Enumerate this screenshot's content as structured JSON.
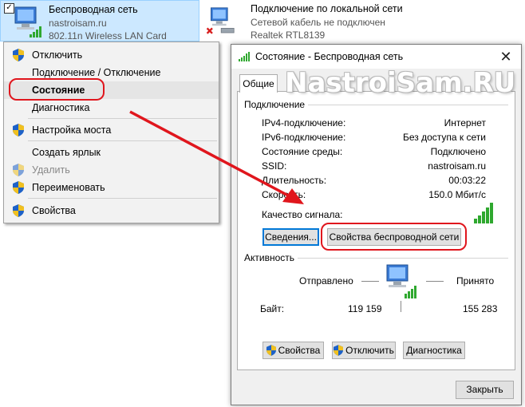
{
  "adapters": [
    {
      "name": "Беспроводная сеть",
      "line2": "nastroisam.ru",
      "line3": "802.11n Wireless LAN Card"
    },
    {
      "name": "Подключение по локальной сети",
      "line2": "Сетевой кабель не подключен",
      "line3": "Realtek RTL8139"
    }
  ],
  "context_menu": {
    "items": [
      {
        "label": "Отключить",
        "icon": "shield-icon",
        "enabled": true
      },
      {
        "label": "Подключение / Отключение",
        "enabled": true
      },
      {
        "label": "Состояние",
        "enabled": true,
        "highlighted": true
      },
      {
        "label": "Диагностика",
        "enabled": true
      },
      {
        "label": "Настройка моста",
        "icon": "shield-icon",
        "enabled": true
      },
      {
        "label": "Создать ярлык",
        "enabled": true
      },
      {
        "label": "Удалить",
        "icon": "shield-icon",
        "enabled": false
      },
      {
        "label": "Переименовать",
        "icon": "shield-icon",
        "enabled": true
      },
      {
        "label": "Свойства",
        "icon": "shield-icon",
        "enabled": true
      }
    ]
  },
  "dialog": {
    "title": "Состояние - Беспроводная сеть",
    "close_symbol": "✕",
    "tab": "Общие",
    "connection": {
      "group_label": "Подключение",
      "rows": [
        {
          "key": "IPv4-подключение:",
          "value": "Интернет"
        },
        {
          "key": "IPv6-подключение:",
          "value": "Без доступа к сети"
        },
        {
          "key": "Состояние среды:",
          "value": "Подключено"
        },
        {
          "key": "SSID:",
          "value": "nastroisam.ru"
        },
        {
          "key": "Длительность:",
          "value": "00:03:22"
        },
        {
          "key": "Скорость:",
          "value": "150.0 Мбит/с"
        }
      ],
      "signal_label": "Качество сигнала:",
      "signal_bars": 5,
      "details_button": "Сведения...",
      "wireless_props_button": "Свойства беспроводной сети"
    },
    "activity": {
      "group_label": "Активность",
      "sent_label": "Отправлено",
      "received_label": "Принято",
      "bytes_label": "Байт:",
      "bytes_sent": "119 159",
      "bytes_received": "155 283"
    },
    "buttons": {
      "properties": "Свойства",
      "disable": "Отключить",
      "diagnose": "Диагностика",
      "close": "Закрыть"
    }
  },
  "watermark": "NastroiSam.RU",
  "colors": {
    "accent": "#0078d7",
    "highlight_red": "#e0161d",
    "selection": "#cce8ff"
  }
}
